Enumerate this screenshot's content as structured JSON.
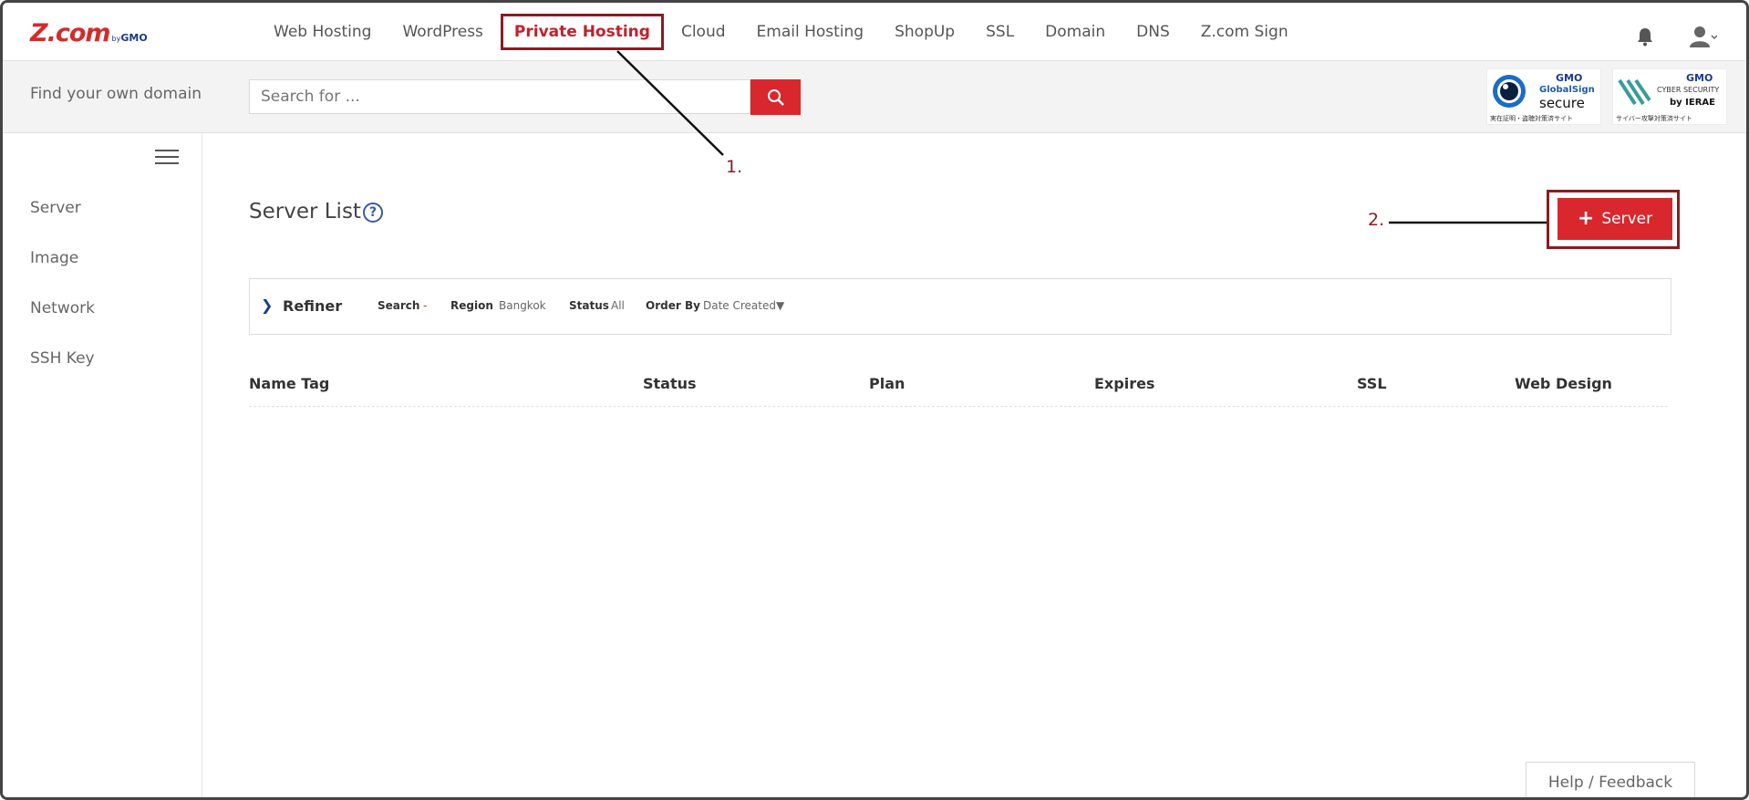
{
  "logo": {
    "brand": "Z.com",
    "by": "by",
    "gmo": "GMO"
  },
  "nav": {
    "items": [
      {
        "label": "Web Hosting"
      },
      {
        "label": "WordPress"
      },
      {
        "label": "Private Hosting",
        "active": true
      },
      {
        "label": "Cloud"
      },
      {
        "label": "Email Hosting"
      },
      {
        "label": "ShopUp"
      },
      {
        "label": "SSL"
      },
      {
        "label": "Domain"
      },
      {
        "label": "DNS"
      },
      {
        "label": "Z.com Sign"
      }
    ],
    "icons": [
      "bell-icon",
      "user-icon",
      "chevron-down-icon"
    ]
  },
  "search": {
    "label": "Find your own domain",
    "placeholder": "Search for ...",
    "button_icon": "search-icon"
  },
  "badges": {
    "globalsign": {
      "gmo": "GMO",
      "name": "GlobalSign",
      "secure": "secure",
      "sub": "実在証明・盗聴対策済サイト"
    },
    "ierae": {
      "gmo": "GMO",
      "name": "CYBER SECURITY",
      "by": "by IERAE",
      "sub": "サイバー攻撃対策済サイト"
    }
  },
  "sidebar": {
    "items": [
      {
        "label": "Server"
      },
      {
        "label": "Image"
      },
      {
        "label": "Network"
      },
      {
        "label": "SSH Key"
      }
    ]
  },
  "main": {
    "title": "Server List",
    "help_icon": "?",
    "add_button": "Server",
    "refiner": {
      "label": "Refiner",
      "search_key": "Search",
      "search_val": "-",
      "region_key": "Region",
      "region_val": "Bangkok",
      "status_key": "Status",
      "status_val": "All",
      "order_key": "Order By",
      "order_val": "Date Created▼"
    },
    "columns": [
      "Name Tag",
      "Status",
      "Plan",
      "Expires",
      "SSL",
      "Web Design"
    ]
  },
  "help_feedback": "Help / Feedback",
  "annotations": {
    "one": "1.",
    "two": "2."
  },
  "colors": {
    "accent": "#d8272d",
    "annotation": "#8a1c24",
    "link": "#1a3a8c"
  }
}
